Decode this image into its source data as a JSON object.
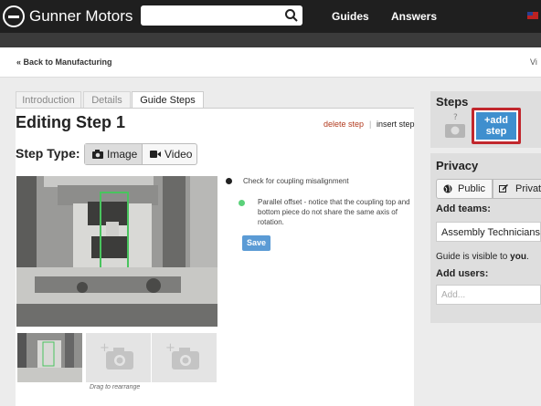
{
  "header": {
    "brand": "Gunner Motors",
    "search_placeholder": "",
    "nav": [
      "Guides",
      "Answers"
    ]
  },
  "breadcrumb": {
    "back": "« Back to Manufacturing",
    "right_partial": "Vi"
  },
  "tabs": [
    {
      "label": "Introduction",
      "active": false
    },
    {
      "label": "Details",
      "active": false
    },
    {
      "label": "Guide Steps",
      "active": true
    }
  ],
  "editor": {
    "title": "Editing Step 1",
    "delete_label": "delete step",
    "separator": "|",
    "insert_label": "insert step",
    "step_type_label": "Step Type:",
    "image_label": "Image",
    "video_label": "Video",
    "drag_hint": "Drag to rearrange",
    "bullets": [
      {
        "text": "Check for coupling misalignment",
        "color": "#222222"
      },
      {
        "text": "Parallel offset - notice that the coupling top and bottom piece do not share the same axis of rotation.",
        "color": "#5bd17a"
      }
    ],
    "save_label": "Save"
  },
  "sidebar": {
    "steps_title": "Steps",
    "add_step_plus": "+add",
    "add_step_word": "step",
    "privacy_title": "Privacy",
    "public_label": "Public",
    "private_label": "Private",
    "add_teams_label": "Add teams:",
    "team_value": "Assembly Technicians",
    "visible_prefix": "Guide is visible to ",
    "visible_who": "you",
    "visible_suffix": ".",
    "add_users_label": "Add users:",
    "users_placeholder": "Add..."
  },
  "colors": {
    "accent": "#3f8fce",
    "danger": "#c1272d",
    "header": "#1f1f1f"
  }
}
